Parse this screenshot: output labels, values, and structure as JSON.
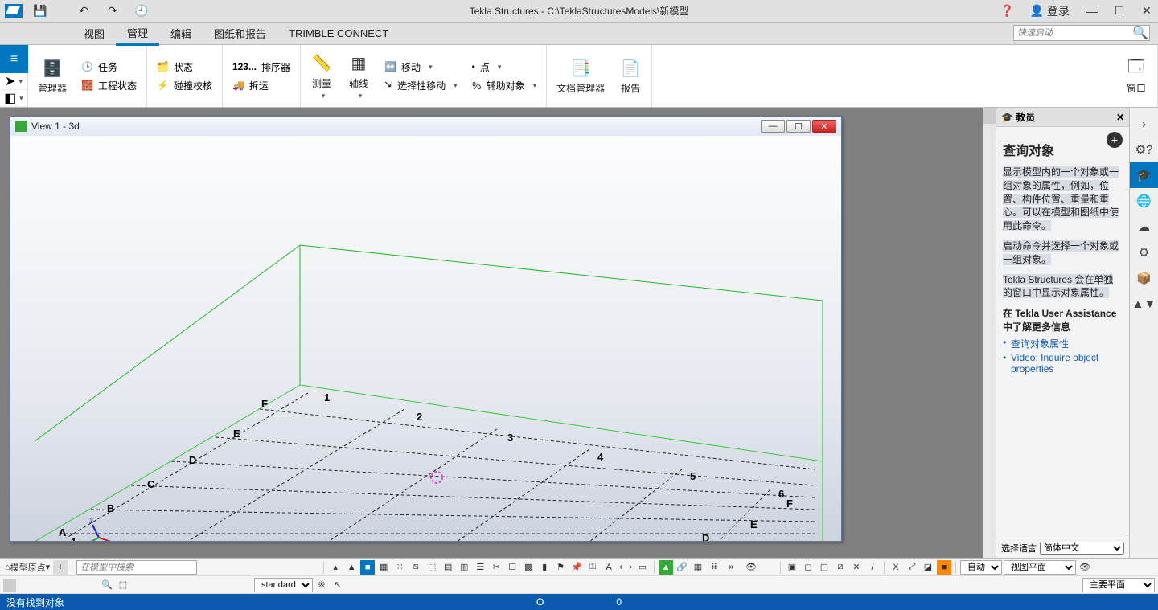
{
  "title": "Tekla Structures - C:\\TeklaStructuresModels\\新模型",
  "login_label": "登录",
  "quick_launch_placeholder": "快速启动",
  "menu_tabs": [
    "视图",
    "管理",
    "编辑",
    "图纸和报告",
    "TRIMBLE CONNECT"
  ],
  "ribbon": {
    "manager": "管理器",
    "task": "任务",
    "job_status": "工程状态",
    "status": "状态",
    "clash_check": "碰撞校核",
    "sequencer": "排序器",
    "sequencer_prefix": "123...",
    "dismantle": "拆运",
    "measure": "测量",
    "grid": "轴线",
    "move": "移动",
    "selective_move": "选择性移动",
    "point": "点",
    "aux_obj": "辅助对象",
    "doc_manager": "文档管理器",
    "report": "报告",
    "window": "窗口"
  },
  "view_window_title": "View 1 - 3d",
  "grid_rows": [
    "A",
    "B",
    "C",
    "D",
    "E",
    "F"
  ],
  "grid_cols": [
    "1",
    "2",
    "3",
    "4",
    "5",
    "6"
  ],
  "side": {
    "header": "教员",
    "title": "查询对象",
    "p1": "显示模型内的一个对象或一组对象的属性，例如，位置、构件位置、重量和重心。可以在模型和图纸中使用此命令。",
    "p2": "启动命令并选择一个对象或一组对象。",
    "p3": "Tekla Structures 会在单独的窗口中显示对象属性。",
    "learn_label": "在 Tekla User Assistance 中了解更多信息",
    "link1": "查询对象属性",
    "link2": "Video: Inquire object properties",
    "lang_label": "选择语言",
    "lang_value": "简体中文"
  },
  "bottom": {
    "origin_label": "模型原点",
    "search_placeholder": "在模型中搜索",
    "standard": "standard",
    "auto": "自动",
    "view_plane": "视图平面",
    "main_plane": "主要平面"
  },
  "status": {
    "msg": "没有找到对象",
    "v1": "O",
    "v2": "0"
  }
}
